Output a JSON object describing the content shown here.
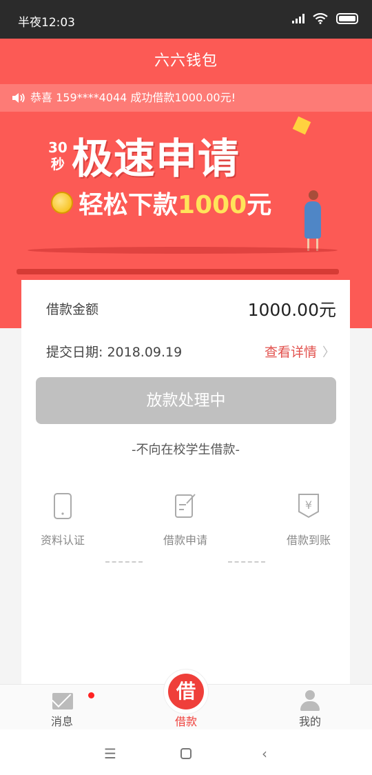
{
  "status_bar": {
    "time": "半夜12:03"
  },
  "header": {
    "title": "六六钱包"
  },
  "notice": {
    "text": "恭喜 159****4044 成功借款1000.00元!"
  },
  "banner": {
    "prefix_top": "30",
    "prefix_bottom": "秒",
    "title": "极速申请",
    "subtitle_pre": "轻松下款",
    "subtitle_amount": "1000",
    "subtitle_post": "元"
  },
  "loan": {
    "amount_label": "借款金额",
    "amount_value": "1000.00元",
    "date_text": "提交日期: 2018.09.19",
    "detail_link": "查看详情",
    "status_button": "放款处理中",
    "note": "-不向在校学生借款-"
  },
  "steps": [
    {
      "label": "资料认证"
    },
    {
      "label": "借款申请"
    },
    {
      "label": "借款到账"
    }
  ],
  "tabbar": {
    "messages": "消息",
    "loan_icon": "借",
    "loan": "借款",
    "mine": "我的",
    "accent": "#ef3f3a"
  },
  "icons": {
    "speaker": "speaker-icon",
    "phone": "phone-icon",
    "edit": "edit-document-icon",
    "yen": "yen-receipt-icon"
  }
}
